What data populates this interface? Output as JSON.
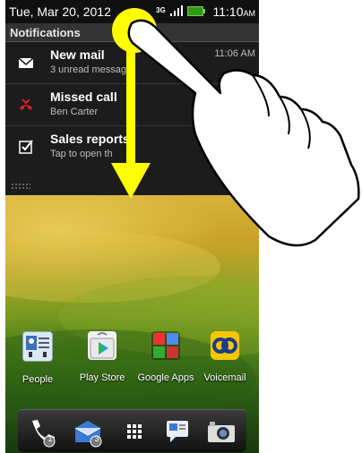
{
  "status_bar": {
    "date": "Tue, Mar 20, 2012",
    "time": "11:10",
    "ampm": "AM",
    "network": "3G"
  },
  "notifications": {
    "header": "Notifications",
    "items": [
      {
        "title": "New mail",
        "subtitle": "3 unread messag",
        "time": "11:06 AM",
        "icon": "mail-icon"
      },
      {
        "title": "Missed call",
        "subtitle": "Ben Carter",
        "time": "",
        "icon": "missed-call-icon"
      },
      {
        "title": "Sales reports",
        "subtitle": "Tap to open th",
        "time": "",
        "icon": "checkbox-icon"
      }
    ]
  },
  "home": {
    "apps": [
      {
        "label": "People",
        "icon": "people-icon"
      },
      {
        "label": "Play Store",
        "icon": "play-store-icon"
      },
      {
        "label": "Google Apps",
        "icon": "google-apps-folder-icon"
      },
      {
        "label": "Voicemail",
        "icon": "voicemail-icon"
      }
    ],
    "dock": {
      "phone_badge": "1",
      "messages_badge": "3",
      "items": [
        "phone-icon",
        "messages-icon",
        "all-apps-icon",
        "chat-icon",
        "camera-icon"
      ]
    }
  },
  "gesture": {
    "type": "swipe-down",
    "arrow_color": "#ffff00",
    "touch_color": "#ffff00"
  }
}
